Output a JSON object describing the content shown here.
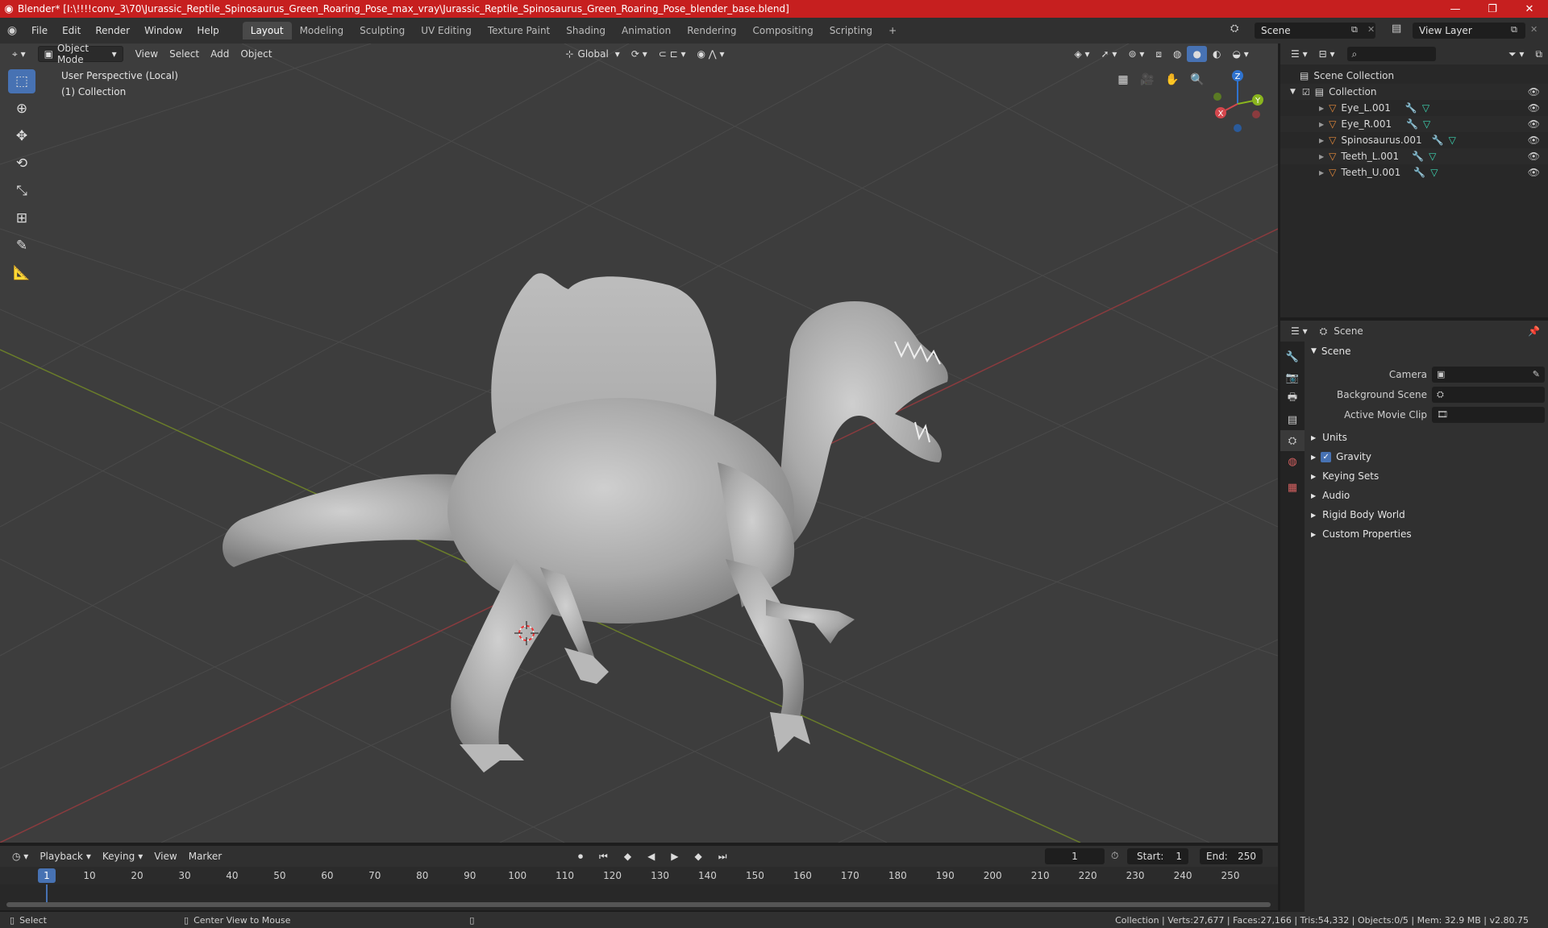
{
  "window": {
    "title": "Blender* [I:\\!!!!conv_3\\70\\Jurassic_Reptile_Spinosaurus_Green_Roaring_Pose_max_vray\\Jurassic_Reptile_Spinosaurus_Green_Roaring_Pose_blender_base.blend]",
    "minimize": "—",
    "maximize": "❐",
    "close": "✕"
  },
  "menubar": {
    "items": [
      "File",
      "Edit",
      "Render",
      "Window",
      "Help"
    ],
    "workspaces": [
      "Layout",
      "Modeling",
      "Sculpting",
      "UV Editing",
      "Texture Paint",
      "Shading",
      "Animation",
      "Rendering",
      "Compositing",
      "Scripting"
    ],
    "add_tab": "+",
    "scene": "Scene",
    "view_layer": "View Layer"
  },
  "viewport": {
    "mode": "Object Mode",
    "menus": [
      "View",
      "Select",
      "Add",
      "Object"
    ],
    "orientation": "Global",
    "info_line1": "User Perspective (Local)",
    "info_line2": "(1) Collection",
    "gizmo": {
      "x": "X",
      "y": "Y",
      "z": "Z"
    }
  },
  "outliner": {
    "root": "Scene Collection",
    "collection": "Collection",
    "objects": [
      "Eye_L.001",
      "Eye_R.001",
      "Spinosaurus.001",
      "Teeth_L.001",
      "Teeth_U.001"
    ]
  },
  "properties": {
    "header": "Scene",
    "panel": "Scene",
    "fields": {
      "camera": "Camera",
      "background_scene": "Background Scene",
      "active_movie_clip": "Active Movie Clip"
    },
    "subpanels": [
      "Units",
      "Gravity",
      "Keying Sets",
      "Audio",
      "Rigid Body World",
      "Custom Properties"
    ]
  },
  "timeline": {
    "menus": [
      "Playback",
      "Keying",
      "View",
      "Marker"
    ],
    "current_frame": "1",
    "start_label": "Start:",
    "start": "1",
    "end_label": "End:",
    "end": "250",
    "ticks": [
      "1",
      "10",
      "20",
      "30",
      "40",
      "50",
      "60",
      "70",
      "80",
      "90",
      "100",
      "110",
      "120",
      "130",
      "140",
      "150",
      "160",
      "170",
      "180",
      "190",
      "200",
      "210",
      "220",
      "230",
      "240",
      "250"
    ]
  },
  "statusbar": {
    "select": "Select",
    "center_view": "Center View to Mouse",
    "stats": "Collection | Verts:27,677 | Faces:27,166 | Tris:54,332 | Objects:0/5 | Mem: 32.9 MB | v2.80.75"
  },
  "colors": {
    "titlebar": "#c61f1f",
    "accent": "#4772b3",
    "viewport_bg": "#3d3d3d",
    "x_axis": "#d4474d",
    "y_axis": "#8ab51e",
    "z_axis": "#2f73cf"
  }
}
